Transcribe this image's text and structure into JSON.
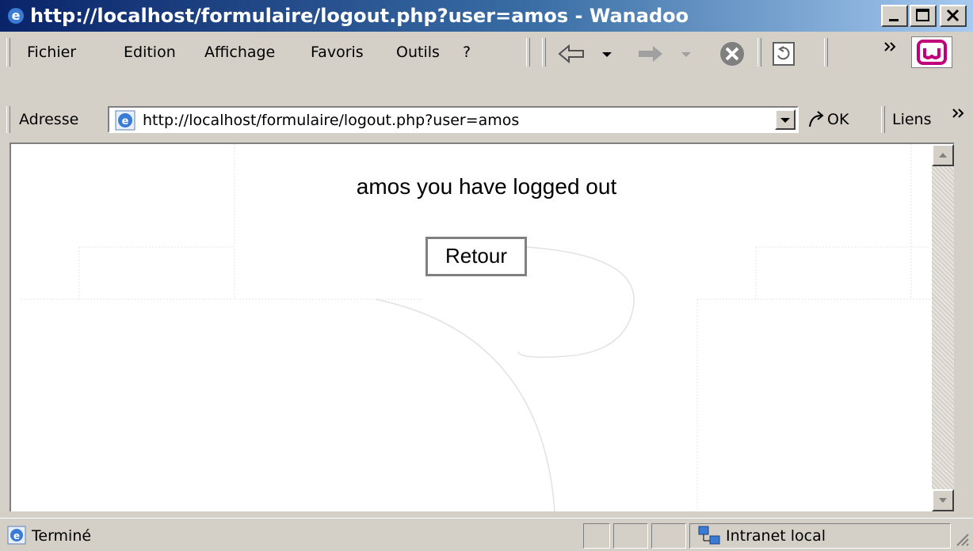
{
  "window": {
    "title": "http://localhost/formulaire/logout.php?user=amos - Wanadoo"
  },
  "menu": {
    "items": [
      {
        "label": "Fichier"
      },
      {
        "label": "Edition"
      },
      {
        "label": "Affichage"
      },
      {
        "label": "Favoris"
      },
      {
        "label": "Outils"
      },
      {
        "label": "?"
      }
    ]
  },
  "address": {
    "label": "Adresse",
    "url": "http://localhost/formulaire/logout.php?user=amos",
    "go_label": "OK",
    "links_label": "Liens"
  },
  "page": {
    "message": "amos you have logged out",
    "button_label": "Retour"
  },
  "status": {
    "text": "Terminé",
    "zone": "Intranet local"
  }
}
